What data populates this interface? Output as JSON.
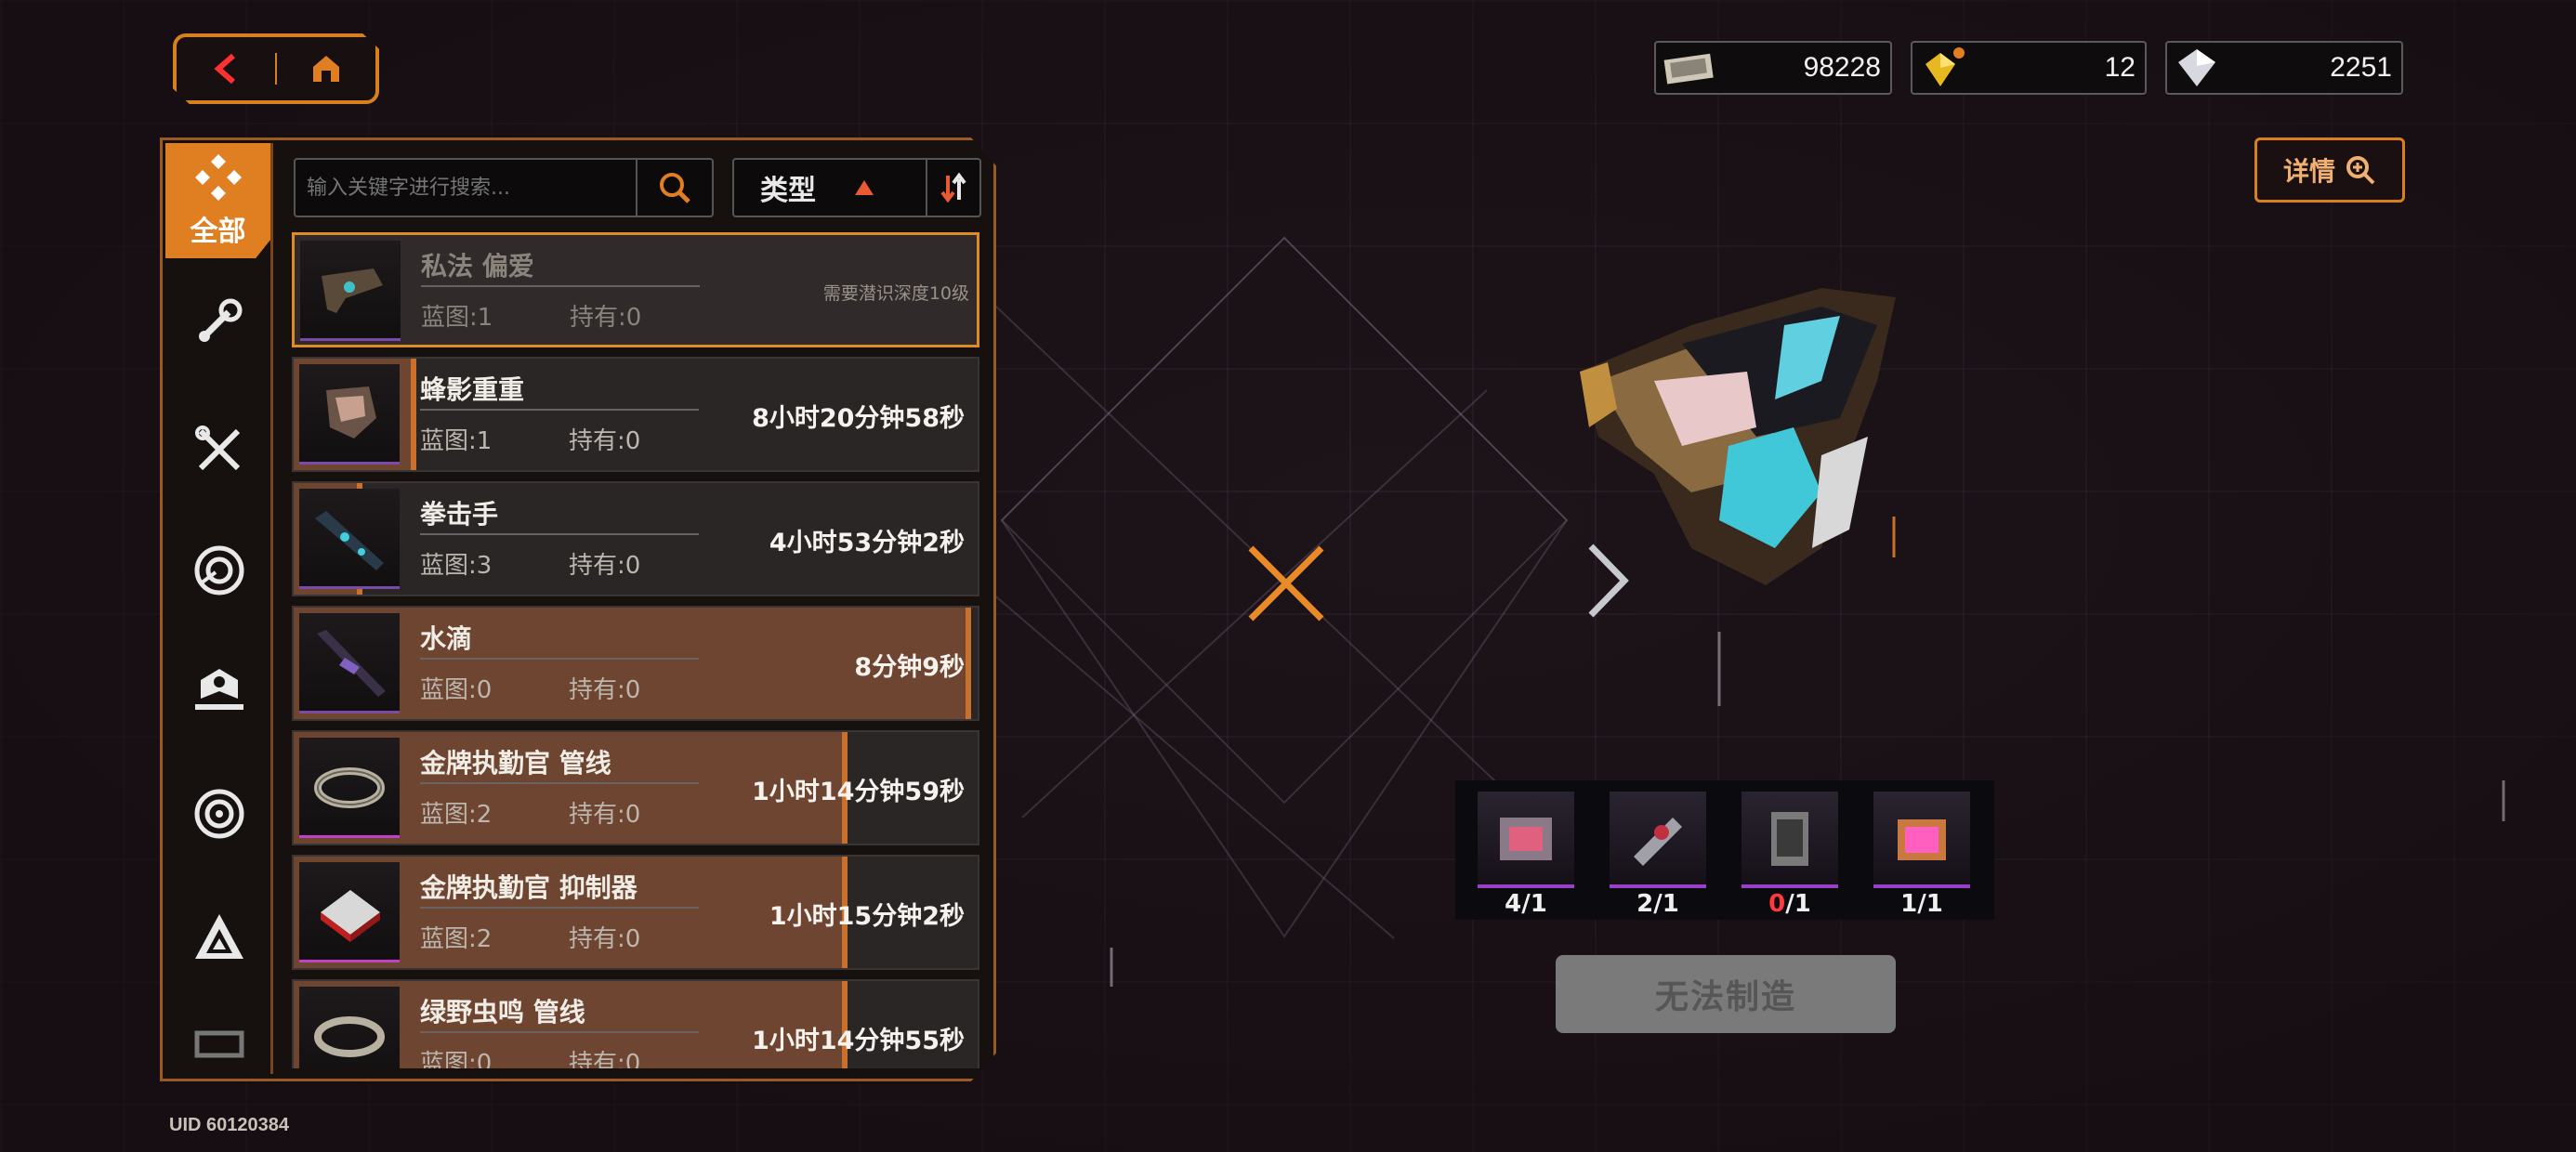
{
  "nav": {
    "back_icon": "back-arrow-icon",
    "home_icon": "home-icon"
  },
  "currencies": [
    {
      "icon": "ticket-icon",
      "value": "98228"
    },
    {
      "icon": "gold-crystal-icon",
      "value": "12"
    },
    {
      "icon": "diamond-icon",
      "value": "2251"
    }
  ],
  "detail_button": {
    "label": "详情"
  },
  "sidebar": {
    "all_label": "全部",
    "tabs": [
      "wrench-icon",
      "tools-icon",
      "scope-icon",
      "badge-icon",
      "spiral-icon",
      "triangle-emblem-icon",
      "more-icon"
    ]
  },
  "search": {
    "placeholder": "输入关键字进行搜索..."
  },
  "filter": {
    "label": "类型"
  },
  "items": [
    {
      "name": "私法 偏爱",
      "blueprint": "蓝图:1",
      "owned": "持有:0",
      "status": "需要潜识深度10级",
      "locked": true,
      "progress": 0
    },
    {
      "name": "蜂影重重",
      "blueprint": "蓝图:1",
      "owned": "持有:0",
      "status": "8小时20分钟58秒",
      "progress": 0.18
    },
    {
      "name": "拳击手",
      "blueprint": "蓝图:3",
      "owned": "持有:0",
      "status": "4小时53分钟2秒",
      "progress": 0.1
    },
    {
      "name": "水滴",
      "blueprint": "蓝图:0",
      "owned": "持有:0",
      "status": "8分钟9秒",
      "progress": 0.99
    },
    {
      "name": "金牌执勤官 管线",
      "blueprint": "蓝图:2",
      "owned": "持有:0",
      "status": "1小时14分钟59秒",
      "progress": 0.81
    },
    {
      "name": "金牌执勤官 抑制器",
      "blueprint": "蓝图:2",
      "owned": "持有:0",
      "status": "1小时15分钟2秒",
      "progress": 0.81
    },
    {
      "name": "绿野虫鸣 管线",
      "blueprint": "蓝图:0",
      "owned": "持有:0",
      "status": "1小时14分钟55秒",
      "progress": 0.81
    }
  ],
  "materials": [
    {
      "have": "4",
      "need": "/1",
      "icon": "material-chip-icon"
    },
    {
      "have": "2",
      "need": "/1",
      "icon": "material-cylinder-icon"
    },
    {
      "have": "0",
      "need": "/1",
      "icon": "material-canister-icon",
      "insufficient": true
    },
    {
      "have": "1",
      "need": "/1",
      "icon": "material-pink-chip-icon"
    }
  ],
  "craft_button": {
    "label": "无法制造"
  },
  "uid": "UID 60120384",
  "colors": {
    "accent": "#e07e22",
    "progress": "#6e4530",
    "insufficient": "#ff3a3a"
  }
}
